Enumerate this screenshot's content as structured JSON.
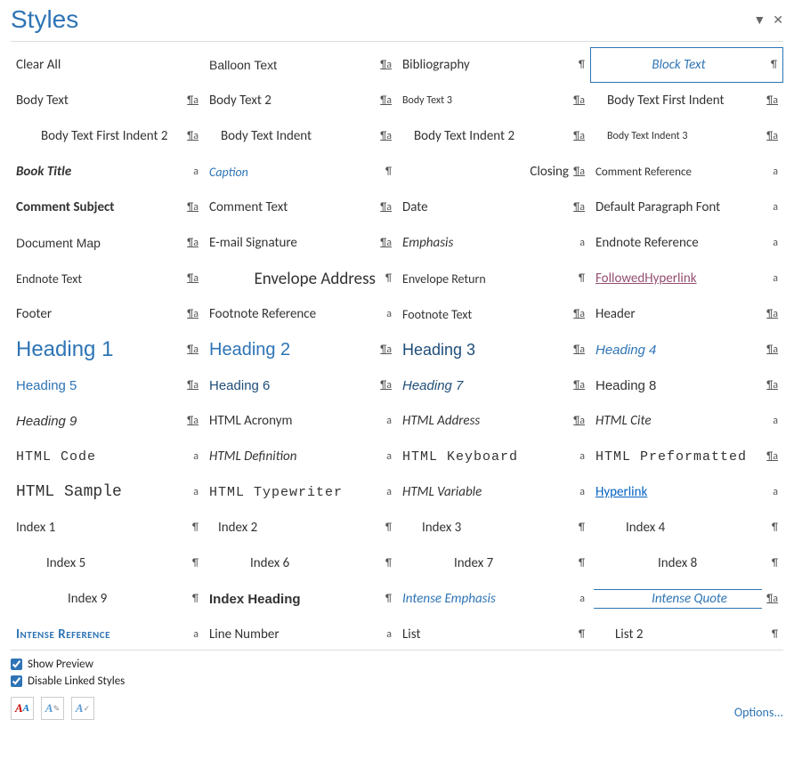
{
  "pane": {
    "title": "Styles",
    "options_label": "Options..."
  },
  "checkboxes": {
    "show_preview": "Show Preview",
    "disable_linked": "Disable Linked Styles"
  },
  "markers": {
    "para": "¶",
    "char": "a",
    "linked": "¶a"
  },
  "buttons": {
    "new_style": "A",
    "inspector": "A",
    "manage": "A"
  },
  "styles": [
    {
      "label": "Clear All",
      "marker": "",
      "css": ""
    },
    {
      "label": "Balloon Text",
      "marker": "linked",
      "css": "font-family:Tahoma,Arial,sans-serif;font-size:14px;"
    },
    {
      "label": "Bibliography",
      "marker": "para",
      "css": ""
    },
    {
      "label": "Block Text",
      "marker": "para",
      "css": "color:#2E74B5;font-style:italic;",
      "selected": true,
      "align": "center"
    },
    {
      "label": "Body Text",
      "marker": "linked",
      "css": ""
    },
    {
      "label": "Body Text 2",
      "marker": "linked",
      "css": ""
    },
    {
      "label": "Body Text 3",
      "marker": "linked",
      "css": "font-size:12px;"
    },
    {
      "label": "Body Text First Indent",
      "marker": "linked",
      "css": "",
      "indent": 15
    },
    {
      "label": "Body Text First Indent 2",
      "marker": "linked",
      "css": "",
      "indent": 30,
      "clip": true
    },
    {
      "label": "Body Text Indent",
      "marker": "linked",
      "css": "",
      "indent": 15
    },
    {
      "label": "Body Text Indent 2",
      "marker": "linked",
      "css": "",
      "indent": 15
    },
    {
      "label": "Body Text Indent 3",
      "marker": "linked",
      "css": "font-size:12px;",
      "indent": 15
    },
    {
      "label": "Book Title",
      "marker": "char",
      "css": "font-weight:bold;font-style:italic;"
    },
    {
      "label": "Caption",
      "marker": "para",
      "css": "font-style:italic;color:#2E74B5;font-size:14px;"
    },
    {
      "label": "Closing",
      "marker": "linked",
      "css": "text-align:right;",
      "align": "right",
      "clip": true
    },
    {
      "label": "Comment Reference",
      "marker": "char",
      "css": "font-size:13px;"
    },
    {
      "label": "Comment Subject",
      "marker": "linked",
      "css": "font-weight:bold;"
    },
    {
      "label": "Comment Text",
      "marker": "linked",
      "css": ""
    },
    {
      "label": "Date",
      "marker": "linked",
      "css": ""
    },
    {
      "label": "Default Paragraph Font",
      "marker": "char",
      "css": ""
    },
    {
      "label": "Document Map",
      "marker": "linked",
      "css": "font-family:Tahoma,Arial,sans-serif;font-size:14px;"
    },
    {
      "label": "E-mail Signature",
      "marker": "linked",
      "css": ""
    },
    {
      "label": "Emphasis",
      "marker": "char",
      "css": "font-style:italic;"
    },
    {
      "label": "Endnote Reference",
      "marker": "char",
      "css": ""
    },
    {
      "label": "Endnote Text",
      "marker": "linked",
      "css": "font-size:14px;"
    },
    {
      "label": "Envelope Address",
      "marker": "para",
      "css": "font-size:19px;",
      "align": "right",
      "clip": true
    },
    {
      "label": "Envelope Return",
      "marker": "para",
      "css": "font-size:14px;"
    },
    {
      "label": "FollowedHyperlink",
      "marker": "char",
      "css": "color:#954F72;text-decoration:underline;"
    },
    {
      "label": "Footer",
      "marker": "linked",
      "css": ""
    },
    {
      "label": "Footnote Reference",
      "marker": "char",
      "css": ""
    },
    {
      "label": "Footnote Text",
      "marker": "linked",
      "css": "font-size:14px;"
    },
    {
      "label": "Header",
      "marker": "linked",
      "css": ""
    },
    {
      "label": "Heading 1",
      "marker": "linked",
      "css": "color:#2E74B5;font-size:24px;font-family:'Calibri Light',Arial,sans-serif;"
    },
    {
      "label": "Heading 2",
      "marker": "linked",
      "css": "color:#2E74B5;font-size:20px;font-family:'Calibri Light',Arial,sans-serif;"
    },
    {
      "label": "Heading 3",
      "marker": "linked",
      "css": "color:#1F4D78;font-size:18px;font-family:'Calibri Light',Arial,sans-serif;"
    },
    {
      "label": "Heading 4",
      "marker": "linked",
      "css": "color:#2E74B5;font-style:italic;font-family:'Calibri Light',Arial,sans-serif;"
    },
    {
      "label": "Heading 5",
      "marker": "linked",
      "css": "color:#2E74B5;font-family:'Calibri Light',Arial,sans-serif;"
    },
    {
      "label": "Heading 6",
      "marker": "linked",
      "css": "color:#1F4D78;font-family:'Calibri Light',Arial,sans-serif;"
    },
    {
      "label": "Heading 7",
      "marker": "linked",
      "css": "color:#1F4D78;font-style:italic;font-family:'Calibri Light',Arial,sans-serif;"
    },
    {
      "label": "Heading 8",
      "marker": "linked",
      "css": "color:#333;font-family:'Calibri Light',Arial,sans-serif;"
    },
    {
      "label": "Heading 9",
      "marker": "linked",
      "css": "font-style:italic;font-family:'Calibri Light',Arial,sans-serif;"
    },
    {
      "label": "HTML Acronym",
      "marker": "char",
      "css": ""
    },
    {
      "label": "HTML Address",
      "marker": "linked",
      "css": "font-style:italic;"
    },
    {
      "label": "HTML Cite",
      "marker": "char",
      "css": "font-style:italic;"
    },
    {
      "label": "HTML Code",
      "marker": "char",
      "css": "font-family:'Courier New',monospace;font-size:15px;letter-spacing:1px;"
    },
    {
      "label": "HTML Definition",
      "marker": "char",
      "css": "font-style:italic;"
    },
    {
      "label": "HTML Keyboard",
      "marker": "char",
      "css": "font-family:'Courier New',monospace;font-size:15px;letter-spacing:1px;"
    },
    {
      "label": "HTML Preformatted",
      "marker": "linked",
      "css": "font-family:'Courier New',monospace;font-size:15px;letter-spacing:1px;"
    },
    {
      "label": "HTML Sample",
      "marker": "char",
      "css": "font-family:'Courier New',monospace;font-size:18px;"
    },
    {
      "label": "HTML Typewriter",
      "marker": "char",
      "css": "font-family:'Courier New',monospace;font-size:15px;letter-spacing:1px;"
    },
    {
      "label": "HTML Variable",
      "marker": "char",
      "css": "font-style:italic;"
    },
    {
      "label": "Hyperlink",
      "marker": "char",
      "css": "color:#0563C1;text-decoration:underline;"
    },
    {
      "label": "Index 1",
      "marker": "para",
      "css": "",
      "indent": 0
    },
    {
      "label": "Index 2",
      "marker": "para",
      "css": "",
      "indent": 12
    },
    {
      "label": "Index 3",
      "marker": "para",
      "css": "",
      "indent": 24
    },
    {
      "label": "Index 4",
      "marker": "para",
      "css": "",
      "indent": 36
    },
    {
      "label": "Index 5",
      "marker": "para",
      "css": "",
      "indent": 36
    },
    {
      "label": "Index 6",
      "marker": "para",
      "css": "",
      "indent": 48
    },
    {
      "label": "Index 7",
      "marker": "para",
      "css": "",
      "indent": 60
    },
    {
      "label": "Index 8",
      "marker": "para",
      "css": "",
      "indent": 72
    },
    {
      "label": "Index 9",
      "marker": "para",
      "css": "",
      "indent": 60
    },
    {
      "label": "Index Heading",
      "marker": "para",
      "css": "font-weight:bold;font-family:'Calibri Light',Arial,sans-serif;"
    },
    {
      "label": "Intense Emphasis",
      "marker": "char",
      "css": "font-style:italic;color:#2E74B5;"
    },
    {
      "label": "Intense Quote",
      "marker": "linked",
      "css": "font-style:italic;color:#2E74B5;border-top:1px solid #2E74B5;border-bottom:1px solid #2E74B5;padding:1px 4px;",
      "align": "center",
      "indent": 30
    },
    {
      "label": "Intense Reference",
      "marker": "char",
      "css": "font-variant:small-caps;color:#2E74B5;font-weight:bold;letter-spacing:0.5px;"
    },
    {
      "label": "Line Number",
      "marker": "char",
      "css": ""
    },
    {
      "label": "List",
      "marker": "para",
      "css": ""
    },
    {
      "label": "List 2",
      "marker": "para",
      "css": "",
      "indent": 24
    }
  ]
}
